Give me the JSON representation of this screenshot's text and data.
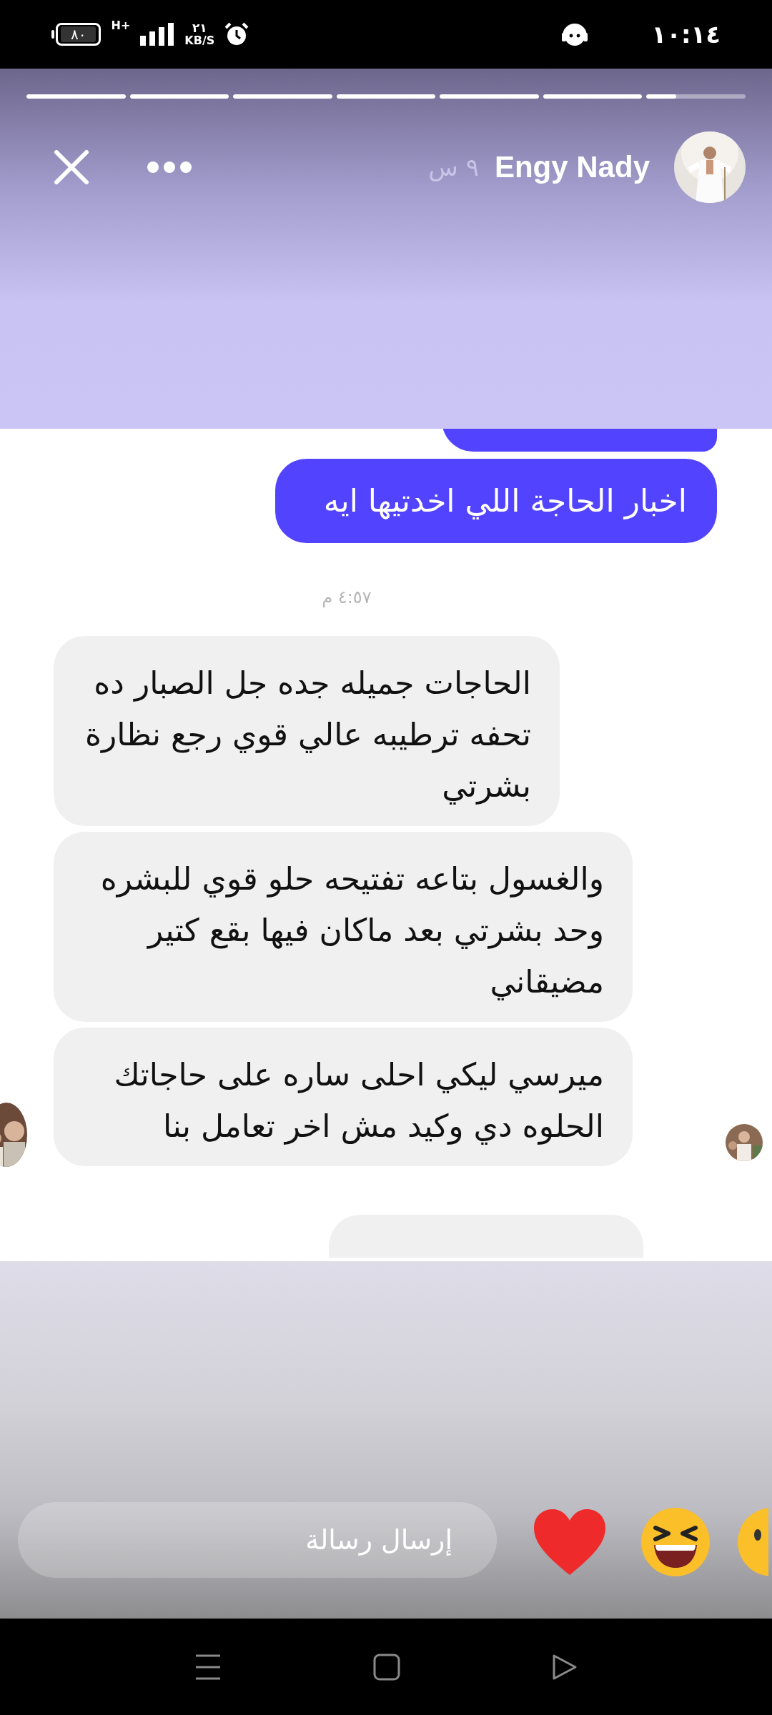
{
  "status_bar": {
    "battery": "٨٠",
    "network": "H+",
    "speed_value": "٢١",
    "speed_unit": "KB/S",
    "time": "١٠:١٤"
  },
  "story": {
    "progress": [
      {
        "level": 1
      },
      {
        "level": 1
      },
      {
        "level": 1
      },
      {
        "level": 1
      },
      {
        "level": 1
      },
      {
        "level": 1
      },
      {
        "level": 0.3
      }
    ],
    "author": "Engy Nady",
    "age": "٩ س"
  },
  "chat": {
    "messages": [
      {
        "kind": "outgoing-cut"
      },
      {
        "kind": "outgoing",
        "text": "اخبار الحاجة اللي اخدتيها ايه"
      },
      {
        "kind": "timestamp",
        "text": "٤:٥٧ م"
      },
      {
        "kind": "incoming",
        "text": "الحاجات جميله جده جل الصبار ده تحفه ترطيبه عالي قوي رجع نظارة بشرتي"
      },
      {
        "kind": "incoming",
        "text": "والغسول بتاعه تفتيحه حلو قوي للبشره وحد بشرتي بعد ماكان فيها بقع كتير مضيقاني"
      },
      {
        "kind": "incoming-last",
        "text": "ميرسي ليكي احلى ساره على حاجاتك الحلوه دي وكيد مش اخر تعامل بنا"
      },
      {
        "kind": "incoming-cut"
      }
    ]
  },
  "reply": {
    "placeholder": "إرسال رسالة"
  }
}
